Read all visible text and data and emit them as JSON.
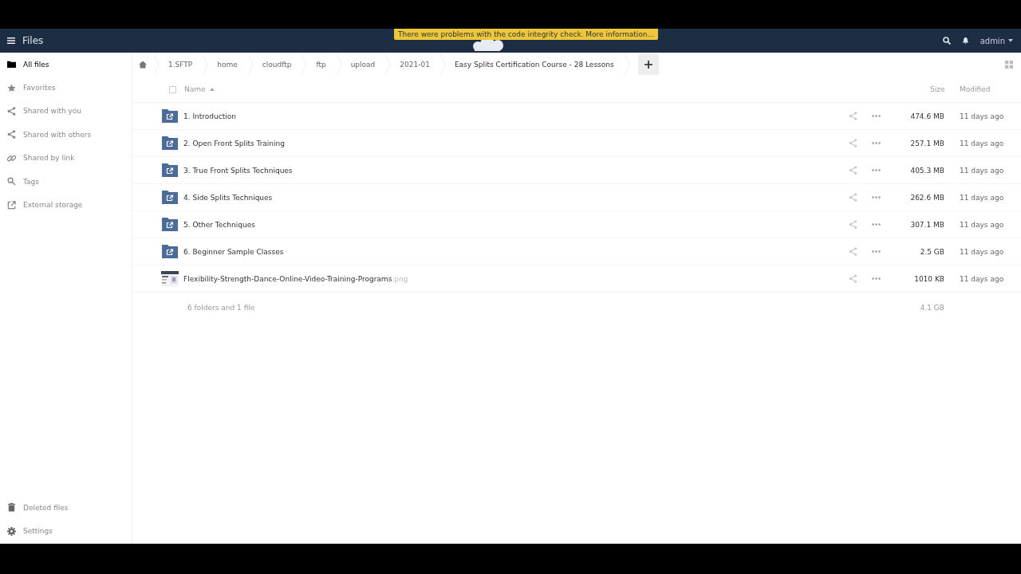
{
  "header": {
    "app_title": "Files",
    "notification": "There were problems with the code integrity check. More information…",
    "user": "admin"
  },
  "sidebar": {
    "items": [
      {
        "label": "All files",
        "selected": true
      },
      {
        "label": "Favorites",
        "selected": false
      },
      {
        "label": "Shared with you",
        "selected": false
      },
      {
        "label": "Shared with others",
        "selected": false
      },
      {
        "label": "Shared by link",
        "selected": false
      },
      {
        "label": "Tags",
        "selected": false
      },
      {
        "label": "External storage",
        "selected": false
      }
    ],
    "footer": [
      {
        "label": "Deleted files"
      },
      {
        "label": "Settings"
      }
    ]
  },
  "breadcrumbs": [
    "1.SFTP",
    "home",
    "cloudftp",
    "ftp",
    "upload",
    "2021-01",
    "Easy Splits Certification Course - 28 Lessons"
  ],
  "table": {
    "select_all": {
      "checked": false
    },
    "columns": {
      "name": "Name",
      "size": "Size",
      "modified": "Modified"
    },
    "rows": [
      {
        "kind": "folder",
        "name": "1. Introduction",
        "size": "474.6 MB",
        "modified": "11 days ago"
      },
      {
        "kind": "folder",
        "name": "2. Open Front Splits Training",
        "size": "257.1 MB",
        "modified": "11 days ago"
      },
      {
        "kind": "folder",
        "name": "3. True Front Splits Techniques",
        "size": "405.3 MB",
        "modified": "11 days ago"
      },
      {
        "kind": "folder",
        "name": "4. Side Splits Techniques",
        "size": "262.6 MB",
        "modified": "11 days ago"
      },
      {
        "kind": "folder",
        "name": "5. Other Techniques",
        "size": "307.1 MB",
        "modified": "11 days ago"
      },
      {
        "kind": "folder",
        "name": "6. Beginner Sample Classes",
        "size": "2.5 GB",
        "modified": "11 days ago"
      },
      {
        "kind": "file",
        "name": "Flexibility-Strength-Dance-Online-Video-Training-Programs",
        "extension": ".png",
        "size": "1010 KB",
        "modified": "11 days ago"
      }
    ],
    "summary": {
      "count": "6 folders and 1 file",
      "size": "4.1 GB"
    }
  }
}
